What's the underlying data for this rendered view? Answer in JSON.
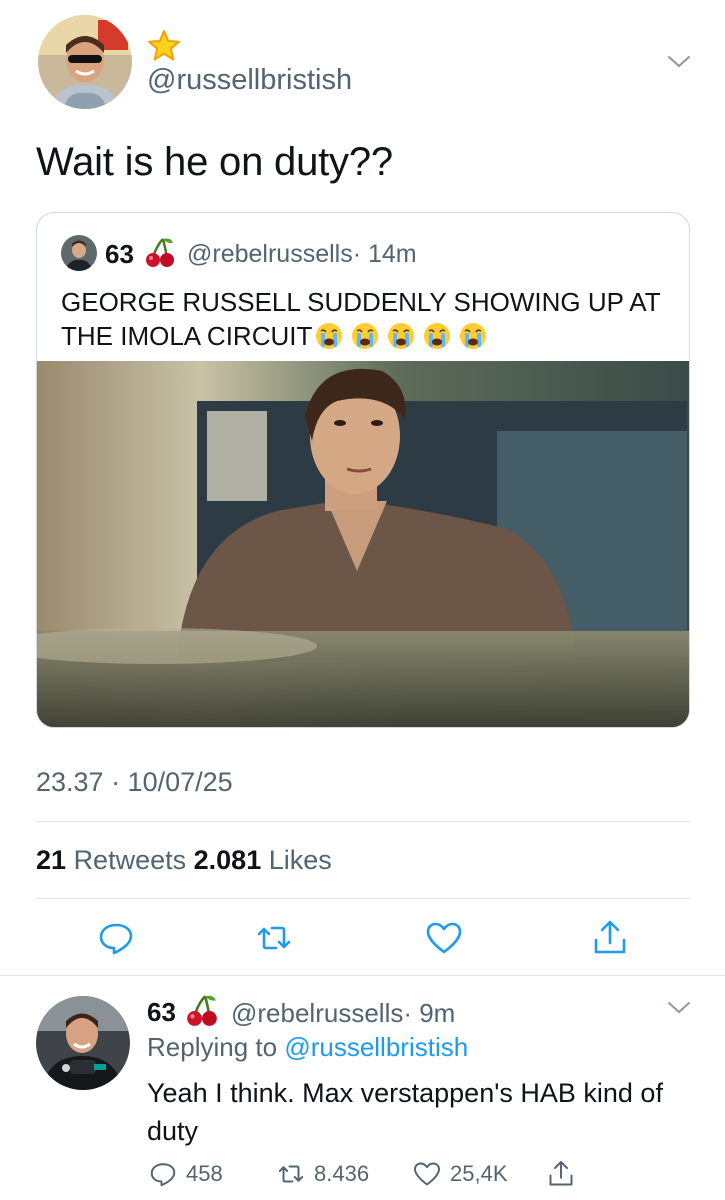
{
  "colors": {
    "text": "#0f1419",
    "secondary": "#536471",
    "link": "#1d9bf0",
    "border": "#cfd9de"
  },
  "main_tweet": {
    "handle": "@russellbristish",
    "text": "Wait is he on duty??",
    "timestamp": "23.37 · 10/07/25",
    "stats": {
      "retweets_count": "21",
      "retweets_label": "Retweets",
      "likes_count": "2.081",
      "likes_label": "Likes"
    },
    "icons": [
      "star-icon",
      "chevron-down-icon",
      "reply-icon",
      "retweet-icon",
      "like-icon",
      "share-icon"
    ]
  },
  "quote": {
    "name": "63",
    "handle": "@rebelrussells",
    "time": "· 14m",
    "text": "GEORGE RUSSELL SUDDENLY SHOWING UP AT THE IMOLA CIRCUIT",
    "emoji_count": 5
  },
  "reply": {
    "name": "63",
    "handle": "@rebelrussells",
    "time": "· 9m",
    "replying_prefix": "Replying to",
    "replying_handle": "@russellbristish",
    "text": "Yeah I think. Max verstappen's HAB kind of duty",
    "replies": "458",
    "retweets": "8.436",
    "likes": "25,4K"
  }
}
